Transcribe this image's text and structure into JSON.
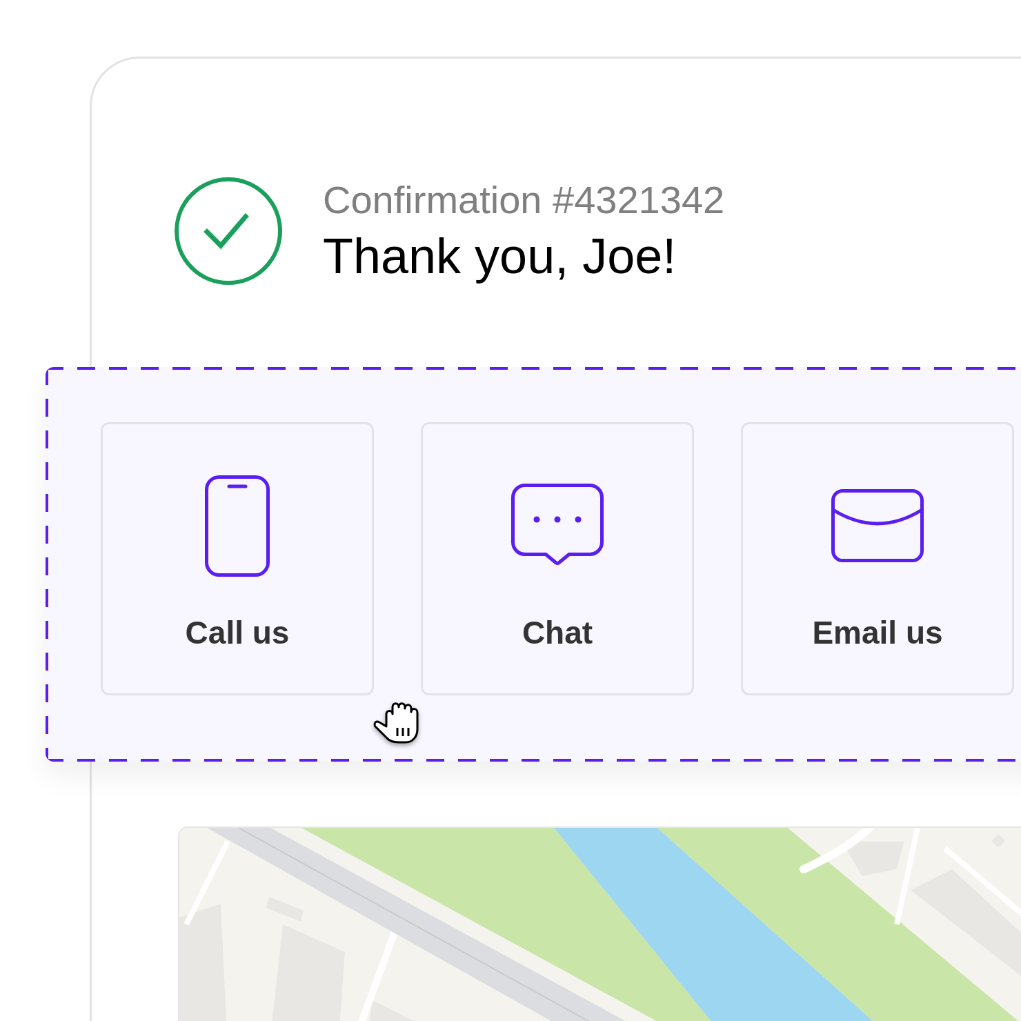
{
  "confirmation": {
    "number_label": "Confirmation #4321342",
    "title": "Thank you, Joe!"
  },
  "contact_options": [
    {
      "kind": "phone",
      "label": "Call us"
    },
    {
      "kind": "chat",
      "label": "Chat"
    },
    {
      "kind": "email",
      "label": "Email us"
    }
  ]
}
